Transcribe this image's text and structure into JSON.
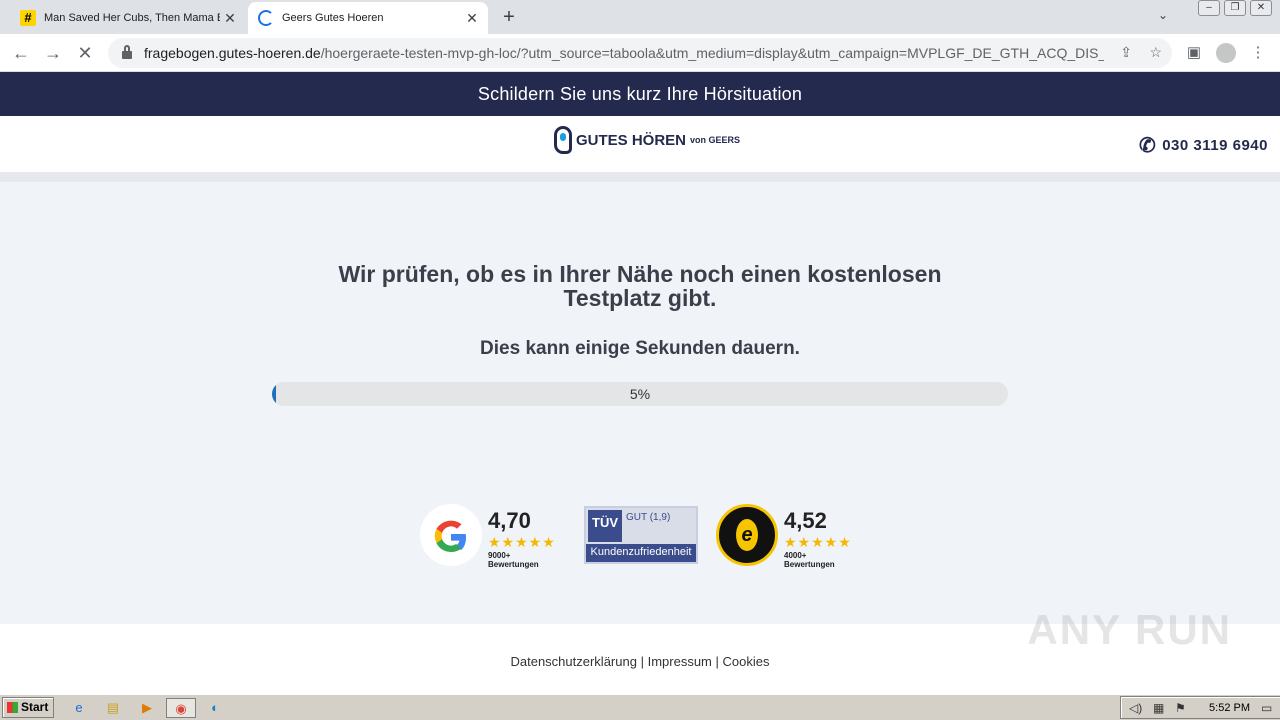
{
  "browser": {
    "tabs": [
      {
        "title": "Man Saved Her Cubs, Then Mama Be",
        "favicon": "hashtag-icon",
        "active": false
      },
      {
        "title": "Geers Gutes Hoeren",
        "favicon": "loading-spinner-icon",
        "active": true
      }
    ],
    "new_tab": "+",
    "tab_close": "✕",
    "url_domain": "fragebogen.gutes-hoeren.de",
    "url_path": "/hoergeraete-testen-mvp-gh-loc/?utm_source=taboola&utm_medium=display&utm_campaign=MVPLGF_DE_GTH_ACQ_DIS_..."
  },
  "page": {
    "banner_text": "Schildern Sie uns kurz Ihre Hörsituation",
    "logo_text": "GUTES HÖREN",
    "logo_suffix": "von GEERS",
    "phone": "030 3119 6940",
    "headline": "Wir prüfen, ob es in Ihrer Nähe noch einen kostenlosen Testplatz gibt.",
    "subline": "Dies kann einige Sekunden dauern.",
    "progress_label": "5%",
    "progress_value": 0.05,
    "google": {
      "rating": "4,70",
      "stars": "★★★★★",
      "count": "9000+ Bewertungen"
    },
    "tuv": {
      "logo": "TÜV",
      "grade": "GUT (1,9)",
      "label": "Kundenzufriedenheit"
    },
    "trusted": {
      "letter": "e",
      "rating": "4,52",
      "stars": "★★★★★",
      "count": "4000+ Bewertungen"
    },
    "footer": {
      "privacy": "Datenschutzerklärung",
      "imprint": "Impressum",
      "cookies": "Cookies",
      "separator": "|"
    }
  },
  "watermark": "ANY RUN",
  "taskbar": {
    "start_label": "Start",
    "clock": "5:52 PM"
  },
  "colors": {
    "banner_bg": "#242a4e",
    "progress_fill": "#1f6fb8",
    "page_bg": "#f0f3f8",
    "star": "#f5b800"
  }
}
